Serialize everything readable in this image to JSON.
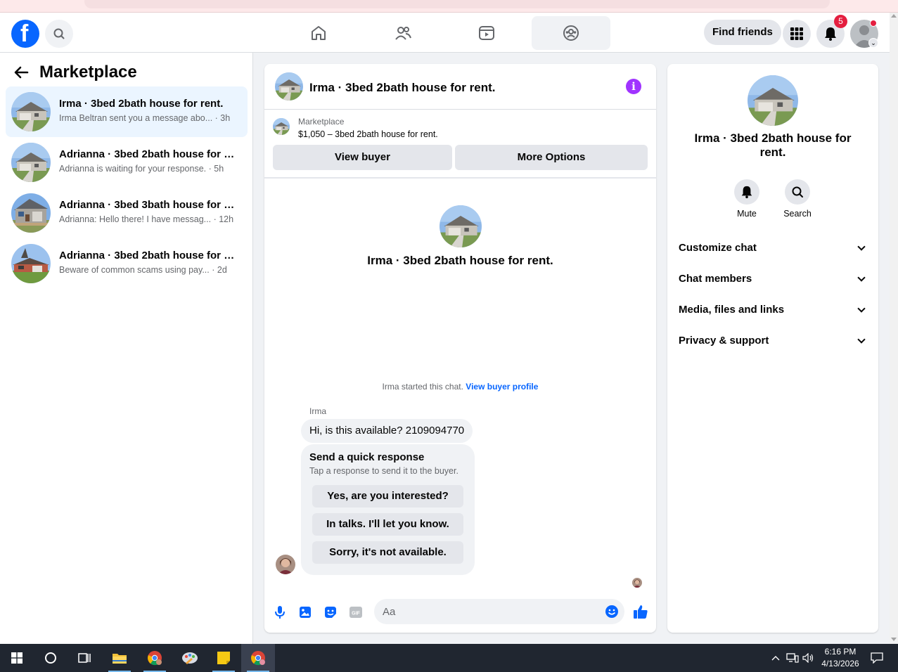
{
  "nav": {
    "find_friends": "Find friends",
    "notification_count": "5"
  },
  "sidebar": {
    "title": "Marketplace",
    "conversations": [
      {
        "title": "Irma · 3bed 2bath house for rent.",
        "preview": "Irma Beltran sent you a message abo...",
        "time": "· 3h",
        "active": true
      },
      {
        "title": "Adrianna · 3bed 2bath house for r...",
        "preview": "Adrianna is waiting for your response.",
        "time": "· 5h",
        "active": false
      },
      {
        "title": "Adrianna · 3bed 3bath house for r...",
        "preview": "Adrianna: Hello there! I have messag...",
        "time": "· 12h",
        "active": false
      },
      {
        "title": "Adrianna · 3bed 2bath house for r...",
        "preview": "Beware of common scams using pay...",
        "time": "· 2d",
        "active": false
      }
    ]
  },
  "chat": {
    "header_title": "Irma · 3bed 2bath house for rent.",
    "marketplace_label": "Marketplace",
    "listing_price": "$1,050 – 3bed 2bath house for rent.",
    "view_buyer": "View buyer",
    "more_options": "More Options",
    "center_title": "Irma · 3bed 2bath house for rent.",
    "started_text": "Irma started this chat.",
    "view_buyer_profile": "View buyer profile",
    "sender_name": "Irma",
    "message": "Hi, is this available? 2109094770",
    "quick_title": "Send a quick response",
    "quick_subtitle": "Tap a response to send it to the buyer.",
    "quick_options": [
      "Yes, are you interested?",
      "In talks. I'll let you know.",
      "Sorry, it's not available."
    ],
    "composer_placeholder": "Aa"
  },
  "details": {
    "title": "Irma · 3bed 2bath house for rent.",
    "mute": "Mute",
    "search": "Search",
    "sections": [
      "Customize chat",
      "Chat members",
      "Media, files and links",
      "Privacy & support"
    ]
  },
  "taskbar": {
    "time": "6:16 PM",
    "date": "4/13/2026"
  },
  "colors": {
    "accent": "#0866ff",
    "info": "#a033ff",
    "badge": "#e41e3f",
    "active_row": "#ebf5ff"
  }
}
